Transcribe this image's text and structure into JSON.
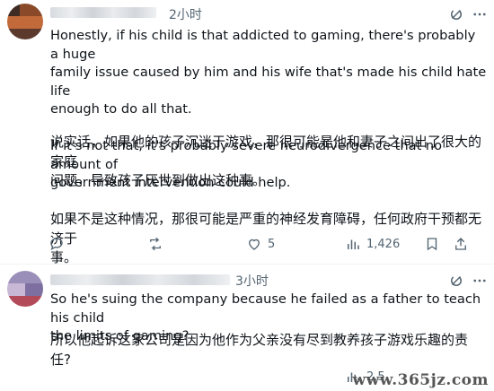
{
  "tweets": [
    {
      "time": "2小时",
      "text_en": "Honestly, if his child is that addicted to gaming, there's probably a huge\nfamily issue caused by him and his wife that's made his child hate life\nenough to do all that.\n\nIf it's not that, it's probably severe neurodivergence that no amount of\ngovernment intervention could help.",
      "text_zh": "说实话，如果他的孩子沉迷于游戏，那很可能是他和妻子之间出了很大的家庭\n问题，导致孩子厌世到做出这种事。\n\n如果不是这种情况，那很可能是严重的神经发育障碍，任何政府干预都无济于\n事。",
      "likes": "5",
      "views": "1,426",
      "avatar_colors": [
        "#3e2b24",
        "#8a4a2a",
        "#c26a3a",
        "#5b3a2d"
      ]
    },
    {
      "time": "3小时",
      "text_en": "So he's suing the company because he failed as a father to teach his child\nthe limits of gaming?",
      "text_zh": "所以他起诉这家公司是因为他作为父亲没有尽到教养孩子游戏乐趣的责任?",
      "views": "2,5",
      "avatar_colors": [
        "#9a8fb8",
        "#c9b7d6",
        "#7d6fa0",
        "#b34a5a"
      ]
    }
  ],
  "watermark": "www.365jz.com",
  "icons": [
    "grok-icon",
    "more-icon",
    "reply-icon",
    "retweet-icon",
    "like-icon",
    "views-icon",
    "bookmark-icon",
    "share-icon"
  ]
}
